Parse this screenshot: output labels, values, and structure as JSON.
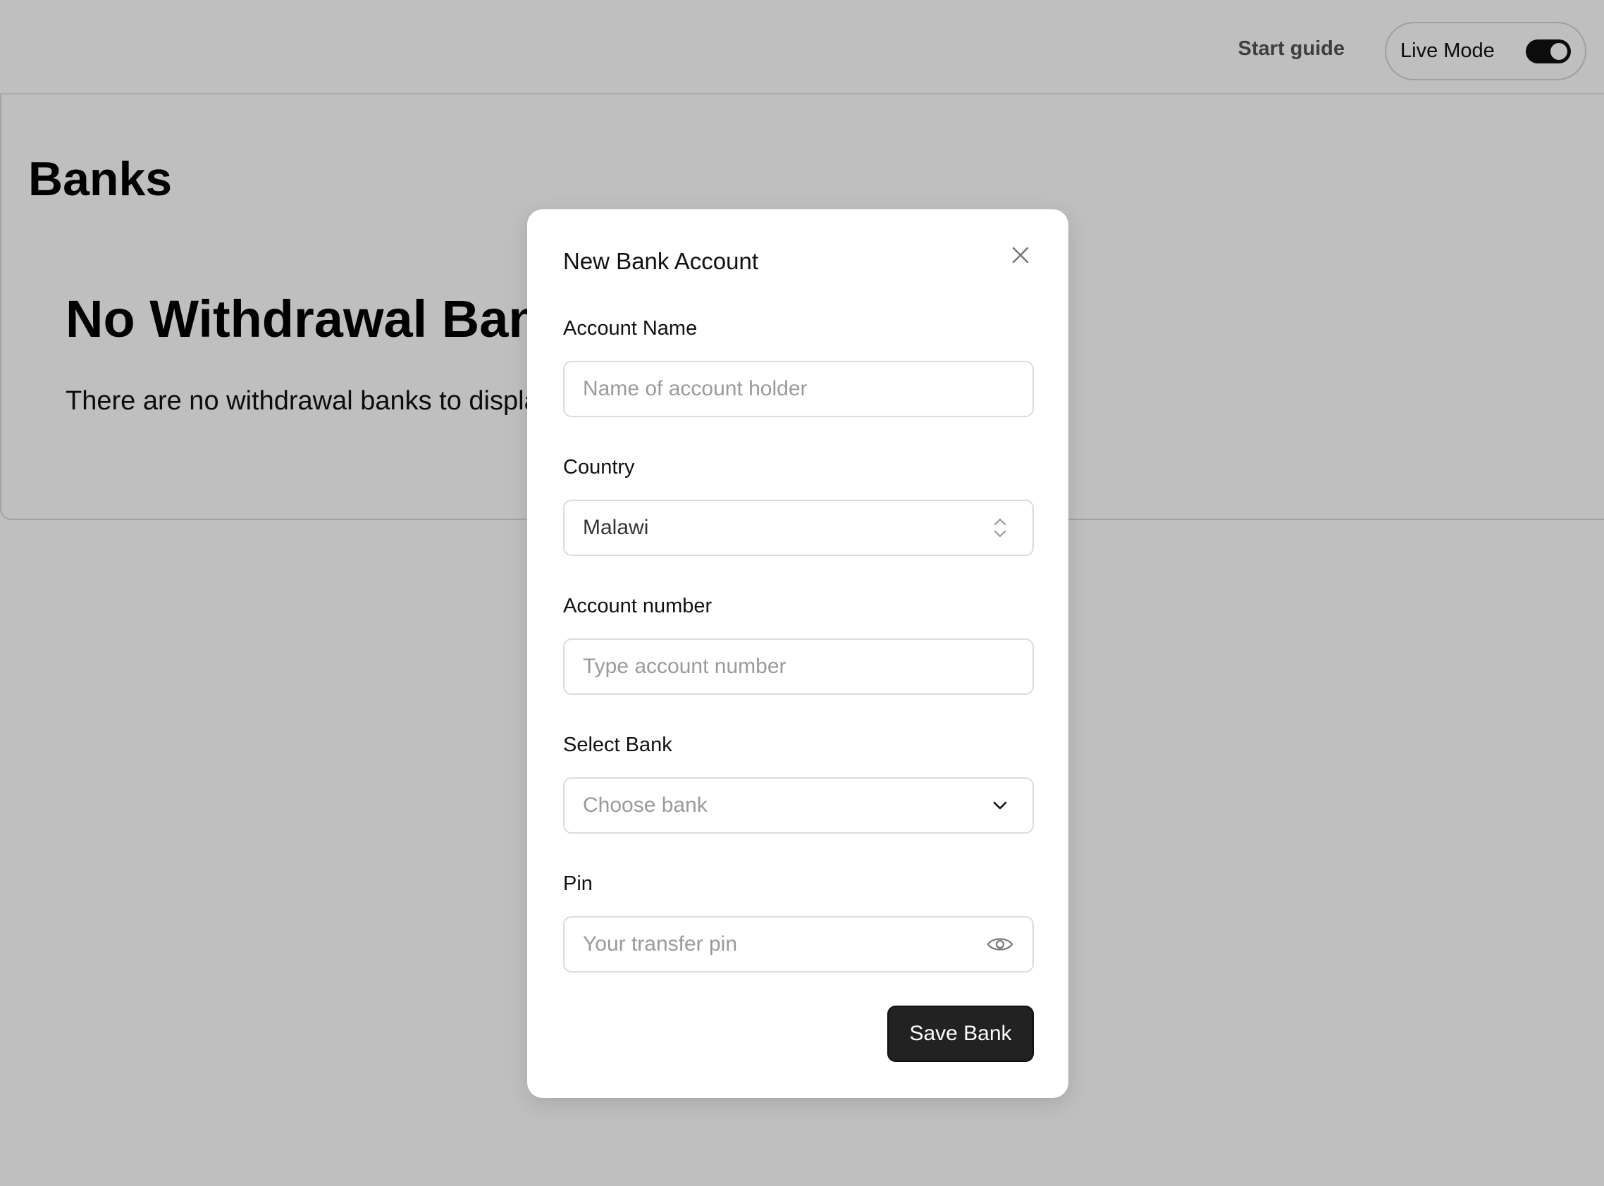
{
  "header": {
    "start_guide_label": "Start guide",
    "live_mode_label": "Live Mode",
    "live_mode_on": true
  },
  "main": {
    "title": "Banks",
    "empty_title": "No Withdrawal Banks",
    "empty_text": "There are no withdrawal banks to display"
  },
  "modal": {
    "title": "New Bank Account",
    "account_name_label": "Account Name",
    "account_name_placeholder": "Name of account holder",
    "country_label": "Country",
    "country_value": "Malawi",
    "account_number_label": "Account number",
    "account_number_placeholder": "Type account number",
    "bank_label": "Select Bank",
    "bank_placeholder": "Choose bank",
    "pin_label": "Pin",
    "pin_placeholder": "Your transfer pin",
    "save_label": "Save Bank"
  },
  "colors": {
    "overlay": "#bfbfbf",
    "button_bg": "#222222",
    "toggle_on": "#111111"
  },
  "icons": [
    "close-icon",
    "chevron-up-down-icon",
    "chevron-down-icon",
    "eye-icon"
  ]
}
